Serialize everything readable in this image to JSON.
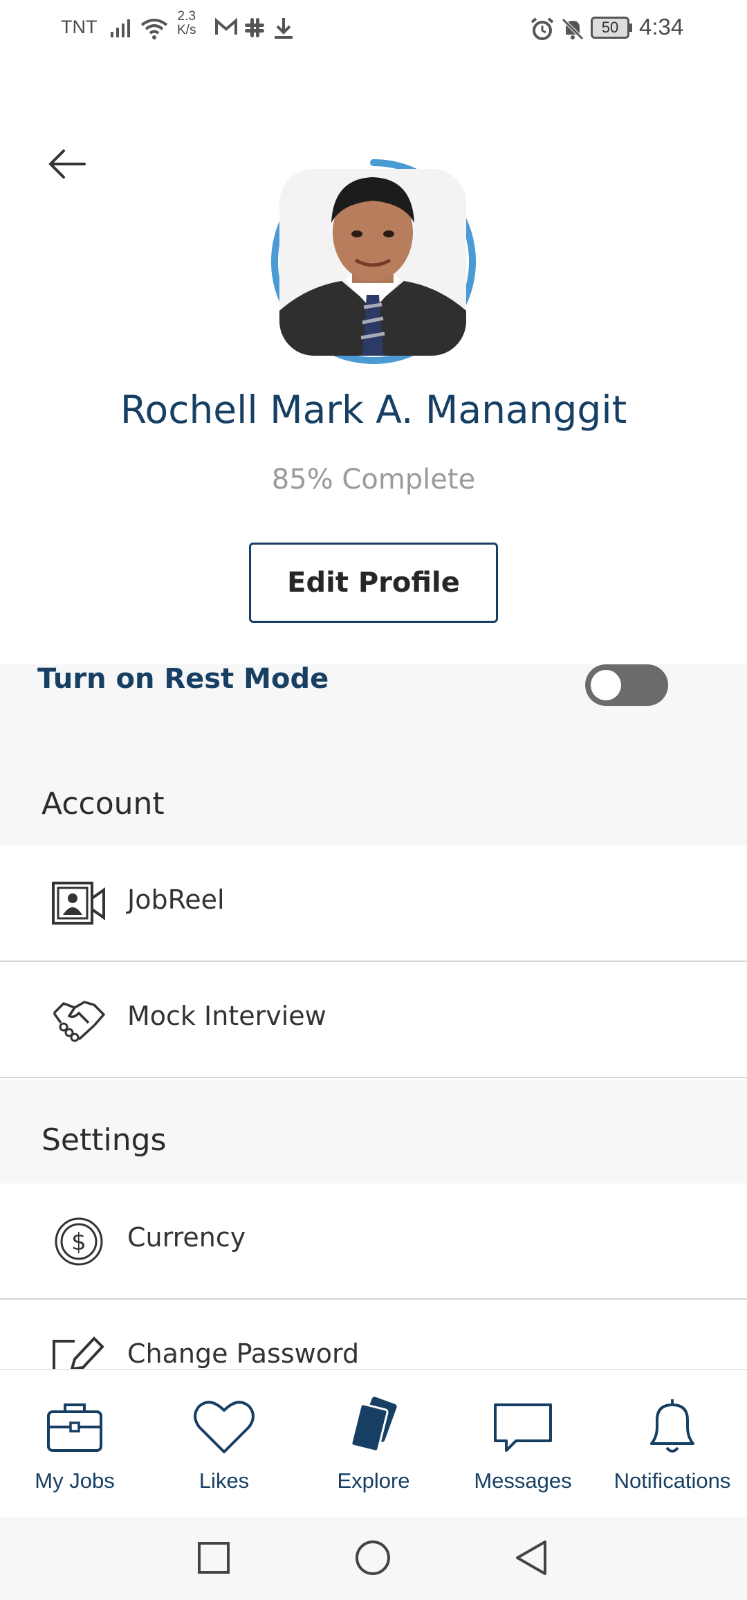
{
  "status_bar": {
    "carrier": "TNT",
    "speed_value": "2.3",
    "speed_unit": "K/s",
    "battery": "50",
    "time": "4:34",
    "icons": [
      "signal-icon",
      "wifi-icon",
      "gmail-icon",
      "slack-icon",
      "download-icon",
      "alarm-icon",
      "mute-icon",
      "battery-icon"
    ]
  },
  "header": {
    "back_icon": "back-arrow-icon",
    "profile_name": "Rochell Mark A. Mananggit",
    "completion_text": "85% Complete",
    "completion_fraction": 0.85,
    "edit_button": "Edit Profile"
  },
  "rest_mode": {
    "label": "Turn on Rest Mode",
    "enabled": false
  },
  "account": {
    "title": "Account",
    "items": [
      {
        "label": "JobReel",
        "icon": "video-profile-icon"
      },
      {
        "label": "Mock Interview",
        "icon": "handshake-icon"
      }
    ]
  },
  "settings": {
    "title": "Settings",
    "items": [
      {
        "label": "Currency",
        "icon": "dollar-circle-icon"
      },
      {
        "label": "Change Password",
        "icon": "edit-icon"
      }
    ]
  },
  "bottom_nav": {
    "items": [
      {
        "label": "My Jobs",
        "icon": "briefcase-icon"
      },
      {
        "label": "Likes",
        "icon": "heart-icon"
      },
      {
        "label": "Explore",
        "icon": "cards-icon"
      },
      {
        "label": "Messages",
        "icon": "chat-icon"
      },
      {
        "label": "Notifications",
        "icon": "bell-icon"
      }
    ]
  },
  "system_nav": {
    "icons": [
      "recents-square-icon",
      "home-circle-icon",
      "back-triangle-icon"
    ]
  },
  "colors": {
    "accent": "#163f63",
    "ring": "#4a9ad4",
    "section_bg": "#f7f7f7"
  }
}
